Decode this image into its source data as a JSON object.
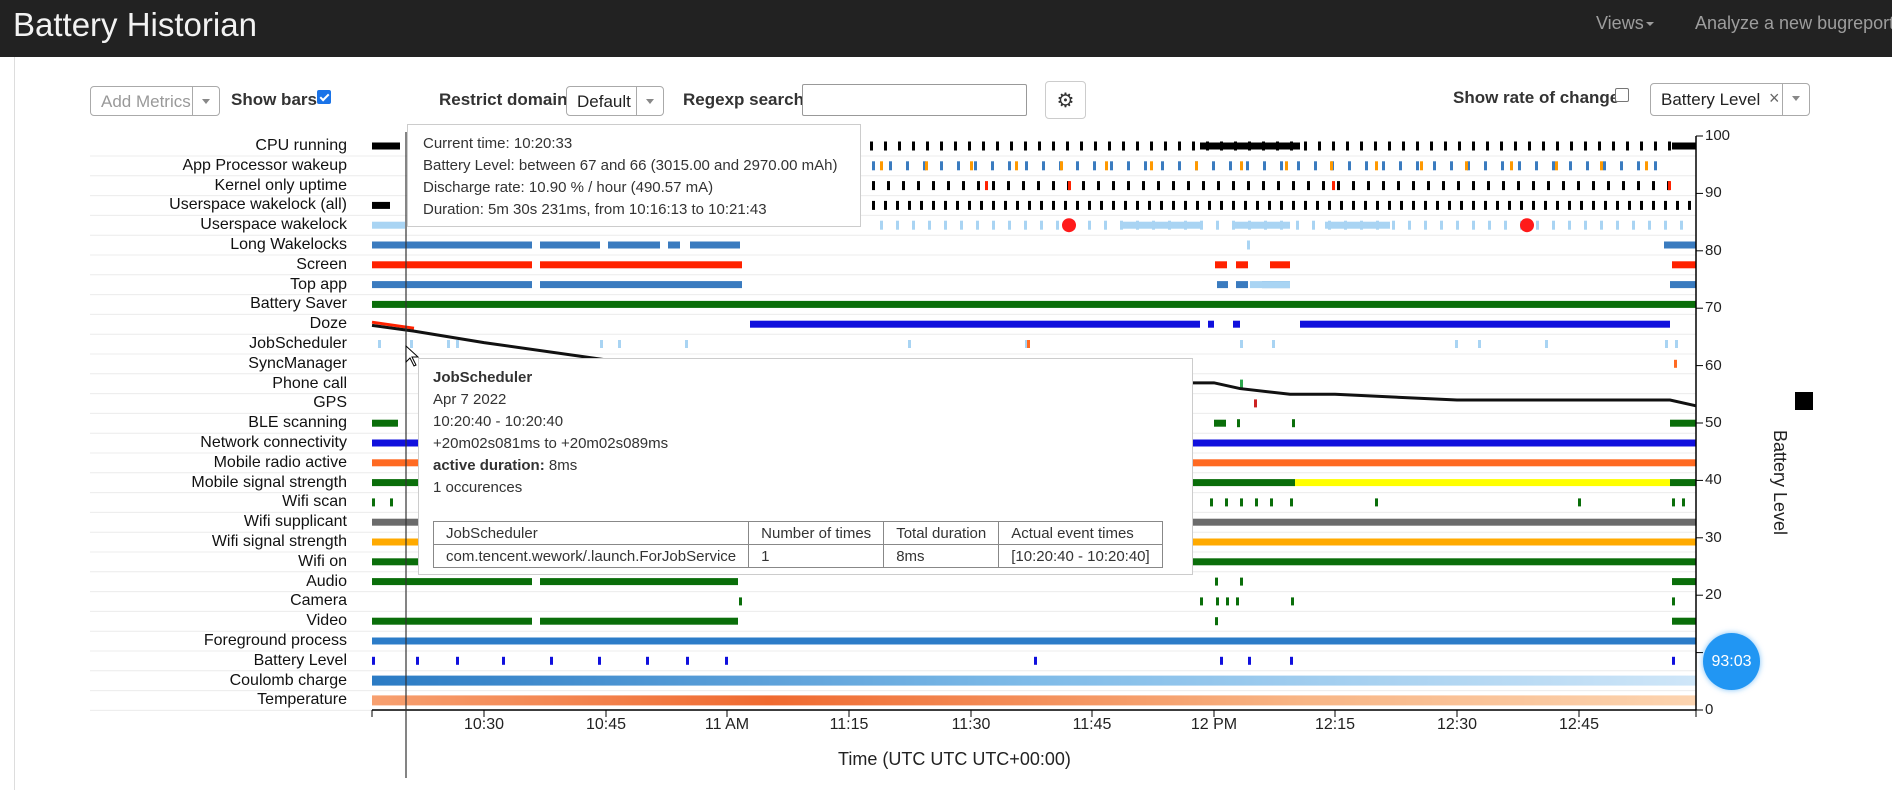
{
  "navbar": {
    "brand": "Battery Historian",
    "views": "Views",
    "analyze": "Analyze a new bugreport"
  },
  "toolbar": {
    "add_metrics_placeholder": "Add Metrics",
    "show_bars_label": "Show bars",
    "show_bars_checked": true,
    "restrict_domain_label": "Restrict domain",
    "restrict_domain_value": "Default",
    "regexp_label": "Regexp search",
    "regexp_value": "",
    "show_rate_label": "Show rate of change",
    "show_rate_checked": false,
    "metric_chip": "Battery Level"
  },
  "rows": [
    "CPU running",
    "App Processor wakeup",
    "Kernel only uptime",
    "Userspace wakelock (all)",
    "Userspace wakelock",
    "Long Wakelocks",
    "Screen",
    "Top app",
    "Battery Saver",
    "Doze",
    "JobScheduler",
    "SyncManager",
    "Phone call",
    "GPS",
    "BLE scanning",
    "Network connectivity",
    "Mobile radio active",
    "Mobile signal strength",
    "Wifi scan",
    "Wifi supplicant",
    "Wifi signal strength",
    "Wifi on",
    "Audio",
    "Camera",
    "Video",
    "Foreground process",
    "Battery Level",
    "Coulomb charge",
    "Temperature"
  ],
  "x_axis": {
    "title": "Time (UTC UTC UTC+00:00)",
    "ticks": [
      "10:30",
      "10:45",
      "11 AM",
      "11:15",
      "11:30",
      "11:45",
      "12 PM",
      "12:15",
      "12:30",
      "12:45"
    ]
  },
  "y_axis": {
    "title": "Battery Level",
    "ticks": [
      "100",
      "90",
      "80",
      "70",
      "60",
      "50",
      "40",
      "30",
      "20",
      "10",
      "0"
    ]
  },
  "tooltip_main": {
    "current_time": "Current time: 10:20:33",
    "battery_level": "Battery Level: between 67 and 66 (3015.00 and 2970.00 mAh)",
    "discharge": "Discharge rate: 10.90 % / hour (490.57 mA)",
    "duration": "Duration: 5m 30s 231ms, from 10:16:13 to 10:21:43"
  },
  "tooltip_job": {
    "title": "JobScheduler",
    "date": "Apr 7 2022",
    "range": "10:20:40 - 10:20:40",
    "offset": "+20m02s081ms to +20m02s089ms",
    "active_label": "active duration:",
    "active_value": "8ms",
    "occurences": "1 occurences",
    "table_headers": [
      "JobScheduler",
      "Number of times",
      "Total duration",
      "Actual event times"
    ],
    "table_row": [
      "com.tencent.wework/.launch.ForJobService",
      "1",
      "8ms",
      "[10:20:40 - 10:20:40]"
    ]
  },
  "battery_badge": "93:03",
  "chart_data": {
    "type": "line",
    "title": "",
    "xlabel": "Time (UTC UTC UTC+00:00)",
    "ylabel": "Battery Level",
    "ylim": [
      0,
      100
    ],
    "x": [
      "10:16",
      "10:20",
      "10:30",
      "10:45",
      "11 AM",
      "11:15",
      "11:30",
      "11:45",
      "12 PM",
      "12:03",
      "12:09",
      "12:15",
      "12:30",
      "12:45",
      "12:55",
      "12:57"
    ],
    "values": [
      67,
      66,
      64,
      61,
      59,
      58,
      57,
      57,
      57,
      56,
      55,
      55,
      54,
      54,
      54,
      53
    ]
  },
  "colors": {
    "black": "#000000",
    "blue": "#3a7bbf",
    "lightblue": "#a9d4f3",
    "red": "#ff2200",
    "green": "#0a6e0a",
    "darkblue": "#1010dd",
    "orange": "#ff6a22",
    "yellow": "#ffff00",
    "gray": "#6b6b6b",
    "amber": "#ffaa00",
    "fg": "#2c7cc8"
  }
}
